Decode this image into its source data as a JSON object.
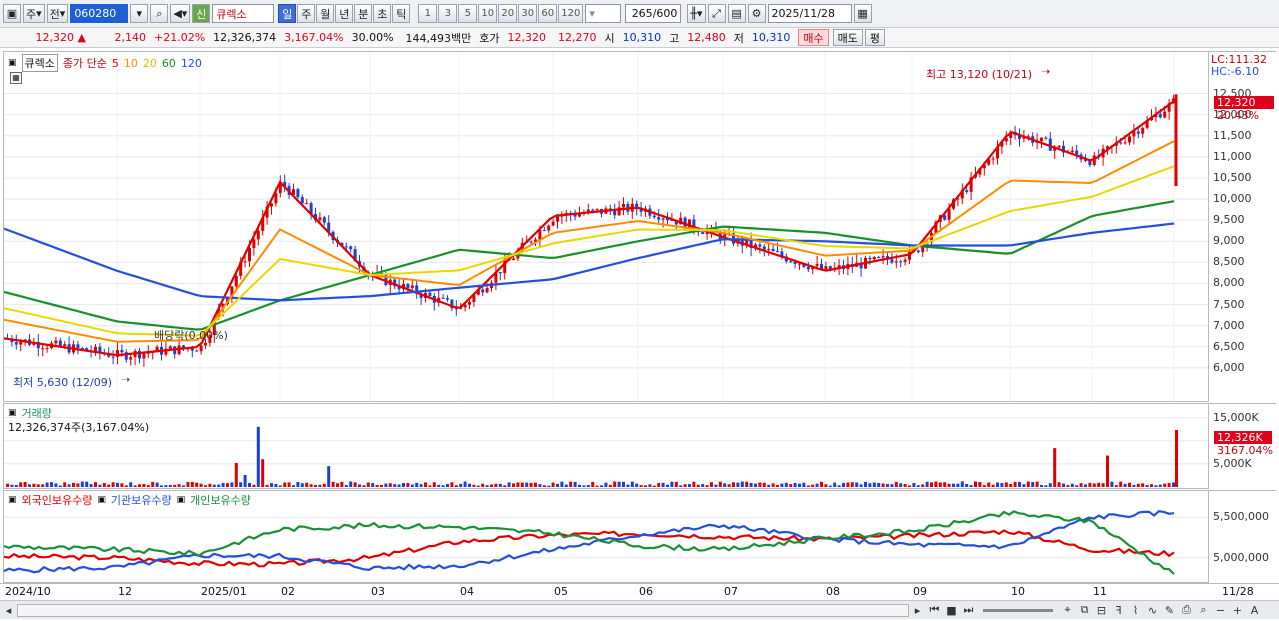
{
  "toolbar": {
    "market_type": "주",
    "prev": "전",
    "stock_code": "060280",
    "new_badge": "신",
    "stock_name": "큐렉소",
    "periods": [
      "일",
      "주",
      "월",
      "년",
      "분",
      "초",
      "틱"
    ],
    "selected_period": "일",
    "intervals": [
      "1",
      "3",
      "5",
      "10",
      "20",
      "30",
      "60",
      "120"
    ],
    "count": "265",
    "count_total": "/600",
    "date": "2025/11/28"
  },
  "quote": {
    "price": "12,320",
    "arrow": "▲",
    "change": "2,140",
    "change_pct": "+21.02%",
    "volume": "12,326,374",
    "volume_pct": "3,167.04%",
    "turnover": "30.00%",
    "amount": "144,493백만",
    "hoga_label": "호가",
    "ask": "12,320",
    "bid": "12,270",
    "open_label": "시",
    "open": "10,310",
    "high_label": "고",
    "high": "12,480",
    "low_label": "저",
    "low": "10,310",
    "buy": "매수",
    "sell": "매도",
    "flat": "평"
  },
  "price_panel": {
    "name": "큐렉소",
    "legend_prefix": "종가 단순",
    "ma_labels": [
      "5",
      "10",
      "20",
      "60",
      "120"
    ],
    "ma_colors": [
      "#e00000",
      "#ff8c00",
      "#e8d800",
      "#1a8f2a",
      "#2450d8"
    ],
    "lc": "LC:111.32",
    "hc": "HC:-6.10",
    "high_note": "최고 13,120 (10/21)",
    "low_note": "최저 5,630 (12/09)",
    "dividend_note": "배당락(0.00%)",
    "last_price_tag": "12,320",
    "last_pct": "20.43%"
  },
  "volume_panel": {
    "title": "거래량",
    "summary": "12,326,374주(3,167.04%)",
    "last_tag": "12,326K",
    "last_pct": "3167.04%"
  },
  "holdings_panel": {
    "legend": [
      "외국인보유수량",
      "기관보유수량",
      "개인보유수량"
    ],
    "colors": [
      "#e00000",
      "#2450d8",
      "#1a8f3a"
    ]
  },
  "xaxis": {
    "labels": [
      "2024/10",
      "12",
      "2025/01",
      "02",
      "03",
      "04",
      "05",
      "06",
      "07",
      "08",
      "09",
      "10",
      "11"
    ],
    "right_label": "11/28"
  },
  "chart_data": [
    {
      "type": "line",
      "title": "큐렉소 일봉",
      "x": [
        "2024/10",
        "12",
        "2025/01",
        "02",
        "03",
        "04",
        "05",
        "06",
        "07",
        "08",
        "09",
        "10",
        "11",
        "11/28"
      ],
      "series": [
        {
          "name": "5",
          "values": [
            6700,
            6300,
            6500,
            10400,
            8200,
            7400,
            9600,
            9800,
            9100,
            8300,
            8700,
            11600,
            10900,
            12320
          ]
        },
        {
          "name": "60",
          "values": [
            7800,
            7100,
            6900,
            7600,
            8200,
            8800,
            8600,
            9000,
            9350,
            9200,
            8900,
            8700,
            9600,
            9950
          ]
        },
        {
          "name": "120",
          "values": [
            9300,
            8300,
            7700,
            7600,
            7700,
            7900,
            8100,
            8600,
            9050,
            9000,
            8900,
            8900,
            9200,
            9420
          ]
        }
      ],
      "ylim": [
        5500,
        13200
      ],
      "yticks": [
        "12,500",
        "12,000",
        "11,500",
        "11,000",
        "10,500",
        "10,000",
        "9,500",
        "9,000",
        "8,500",
        "8,000",
        "7,500",
        "7,000",
        "6,500",
        "6,000"
      ]
    },
    {
      "type": "bar",
      "title": "거래량",
      "yticks": [
        "15,000K",
        "10,000K",
        "5,000K"
      ],
      "ylim": [
        0,
        16000
      ],
      "last_value_k": 12326
    },
    {
      "type": "line",
      "title": "보유수량",
      "yticks": [
        "5,500,000",
        "5,000,000"
      ],
      "ylim": [
        4750000,
        5700000
      ]
    }
  ]
}
